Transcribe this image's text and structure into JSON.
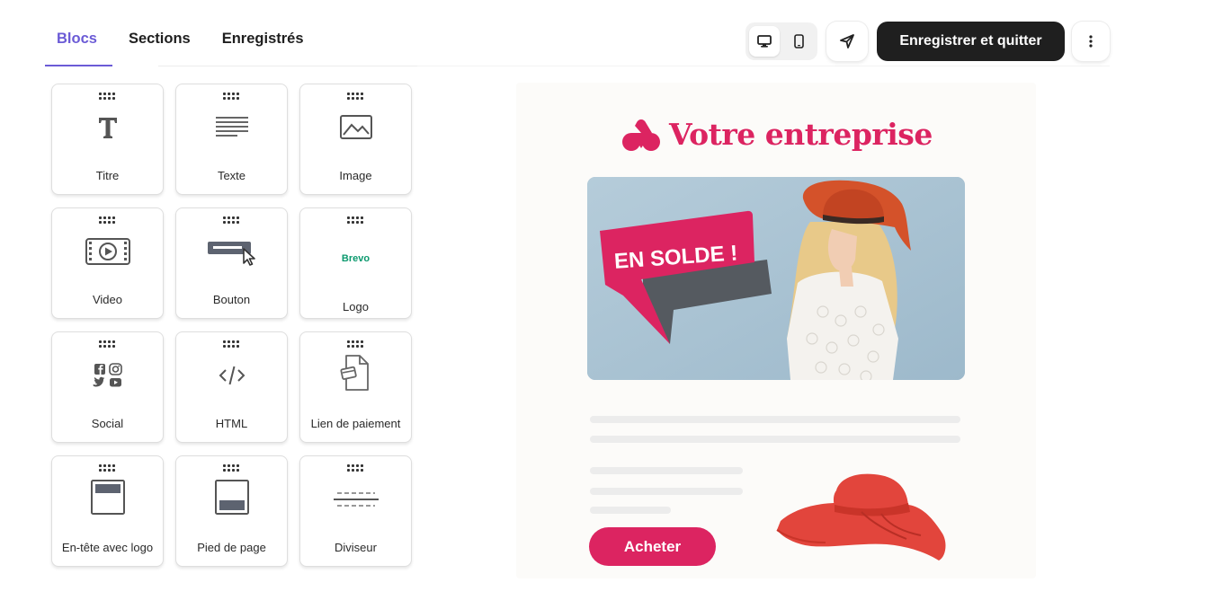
{
  "tabs": [
    {
      "label": "Blocs",
      "active": true
    },
    {
      "label": "Sections",
      "active": false
    },
    {
      "label": "Enregistrés",
      "active": false
    }
  ],
  "toolbar": {
    "save_quit_label": "Enregistrer et quitter",
    "device_active": "desktop-icon",
    "icons": [
      "desktop-icon",
      "mobile-icon",
      "send-icon",
      "more-vertical-icon"
    ]
  },
  "blocks": [
    {
      "label": "Titre",
      "icon": "title-icon"
    },
    {
      "label": "Texte",
      "icon": "text-icon"
    },
    {
      "label": "Image",
      "icon": "image-icon"
    },
    {
      "label": "Video",
      "icon": "video-icon"
    },
    {
      "label": "Bouton",
      "icon": "button-icon"
    },
    {
      "label": "Logo",
      "icon": "logo-icon",
      "logo_text": "Brevo"
    },
    {
      "label": "Social",
      "icon": "social-icon"
    },
    {
      "label": "HTML",
      "icon": "code-icon"
    },
    {
      "label": "Lien de paiement",
      "icon": "payment-link-icon"
    },
    {
      "label": "En-tête avec logo",
      "icon": "header-logo-icon"
    },
    {
      "label": "Pied de page",
      "icon": "footer-icon"
    },
    {
      "label": "Diviseur",
      "icon": "divider-icon"
    }
  ],
  "preview": {
    "brand_name": "Votre entreprise",
    "hero_banner": "EN SOLDE !",
    "buy_button": "Acheter",
    "colors": {
      "accent": "#dc2461",
      "hero_bg": "#a9c3d4",
      "hat": "#e2453c"
    }
  }
}
